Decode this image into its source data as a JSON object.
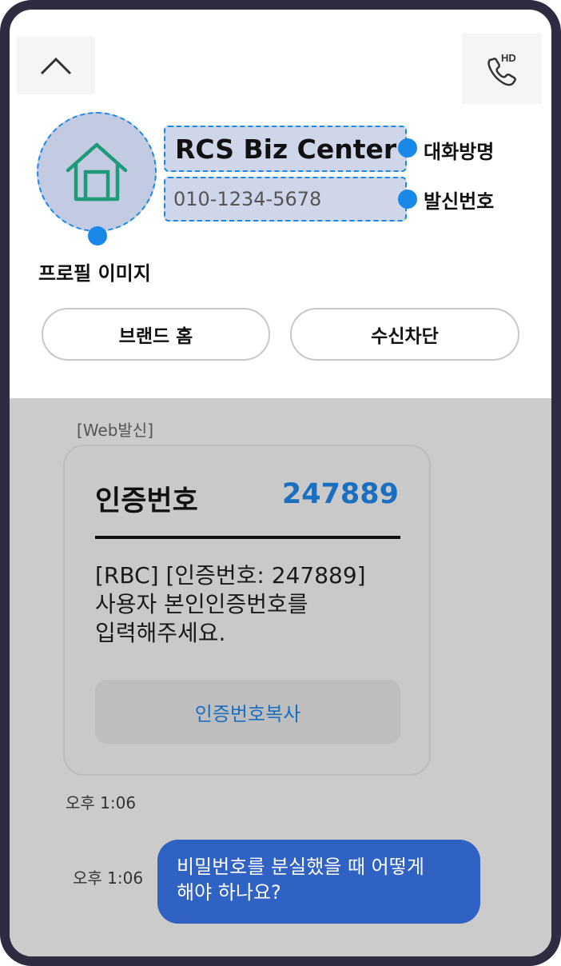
{
  "header": {
    "back_icon": "chevron-up-icon",
    "call_icon": "hd-call-icon",
    "call_badge": "HD"
  },
  "profile": {
    "icon": "home-icon",
    "name": "RCS Biz Center",
    "number": "010-1234-5678"
  },
  "annotations": {
    "name_label": "대화방명",
    "number_label": "발신번호",
    "profile_label": "프로필 이미지"
  },
  "actions": {
    "brand_home": "브랜드 홈",
    "block": "수신차단"
  },
  "chat": {
    "sender_tag": "[Web발신]",
    "card": {
      "title": "인증번호",
      "code": "247889",
      "body_lines": [
        "[RBC] [인증번호: 247889]",
        "사용자 본인인증번호를",
        "입력해주세요."
      ],
      "copy_button": "인증번호복사"
    },
    "incoming_time": "오후 1:06",
    "outgoing": {
      "lines": [
        "비밀번호를 분실했을 때 어떻게",
        "해야 하나요?"
      ],
      "time": "오후 1:06"
    }
  },
  "colors": {
    "frame": "#2f2b41",
    "accent_blue": "#1a88e8",
    "code_blue": "#1a6fc0",
    "bubble_blue": "#3062c4",
    "chat_bg": "#cbcbcb",
    "home_icon_green": "#1e9a78"
  }
}
